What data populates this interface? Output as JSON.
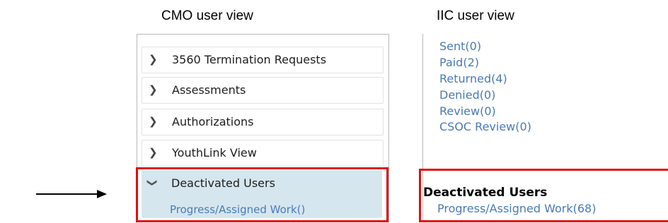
{
  "cmo": {
    "title": "CMO user view",
    "items": [
      {
        "label": "3560 Termination Requests",
        "icon": "chevron-right-icon"
      },
      {
        "label": "Assessments",
        "icon": "chevron-right-icon"
      },
      {
        "label": "Authorizations",
        "icon": "chevron-right-icon"
      },
      {
        "label": "YouthLink View",
        "icon": "chevron-right-icon"
      },
      {
        "label": "Deactivated Users",
        "icon": "chevron-down-icon"
      }
    ],
    "sub_item": "Progress/Assigned Work()"
  },
  "iic": {
    "title": "IIC user view",
    "links": [
      "Sent(0)",
      "Paid(2)",
      "Returned(4)",
      "Denied(0)",
      "Review(0)",
      "CSOC Review(0)"
    ],
    "heading": "Deactivated Users",
    "sub_item": "Progress/Assigned Work(68)"
  },
  "colors": {
    "highlight": "#e01010",
    "link": "#4a7ab8",
    "selected_bg": "#d5e6ee"
  }
}
